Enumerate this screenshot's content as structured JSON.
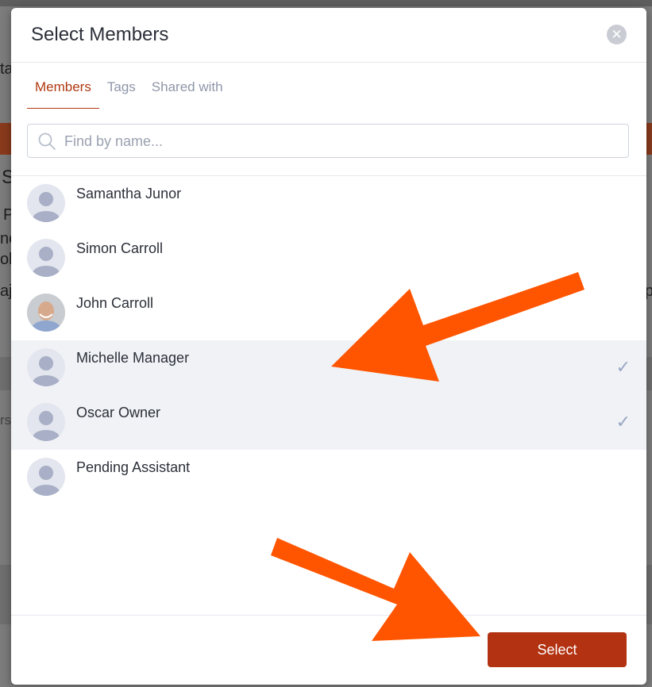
{
  "dialog": {
    "title": "Select Members",
    "close_glyph": "✕"
  },
  "tabs": [
    {
      "label": "Members",
      "active": true
    },
    {
      "label": "Tags",
      "active": false
    },
    {
      "label": "Shared with",
      "active": false
    }
  ],
  "search": {
    "placeholder": "Find by name...",
    "value": ""
  },
  "members": [
    {
      "name": "Samantha Junor",
      "avatar": "person-placeholder-icon",
      "selected": false
    },
    {
      "name": "Simon Carroll",
      "avatar": "person-placeholder-icon",
      "selected": false
    },
    {
      "name": "John Carroll",
      "avatar": "photo",
      "selected": false
    },
    {
      "name": "Michelle Manager",
      "avatar": "person-placeholder-icon",
      "selected": true
    },
    {
      "name": "Oscar Owner",
      "avatar": "person-placeholder-icon",
      "selected": true
    },
    {
      "name": "Pending Assistant",
      "avatar": "person-placeholder-icon",
      "selected": false
    }
  ],
  "check_glyph": "✓",
  "footer": {
    "select_label": "Select"
  },
  "colors": {
    "accent": "#b03a12",
    "button": "#b33211",
    "annotation_arrow": "#ff5500",
    "selected_row": "#f0f2f6"
  },
  "background": {
    "fragments": [
      "ta",
      "S",
      "P",
      "ne",
      "olo",
      "aj",
      "rsi",
      "p"
    ]
  }
}
